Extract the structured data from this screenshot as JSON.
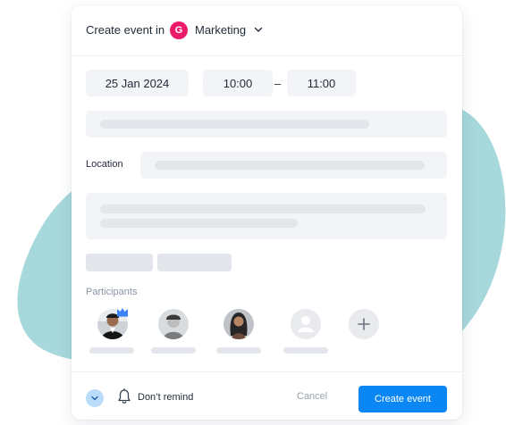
{
  "header": {
    "prefix": "Create event in",
    "team_badge": "G",
    "team_name": "Marketing",
    "team_dropdown_icon": "chevron-down-icon"
  },
  "when": {
    "date": "25 Jan 2024",
    "start_time": "10:00",
    "separator": "–",
    "end_time": "11:00"
  },
  "location": {
    "label": "Location"
  },
  "participants": {
    "label": "Participants",
    "organizer_icon": "crown-icon",
    "add_icon": "plus-icon",
    "placeholder_icon": "user-silhouette-icon"
  },
  "footer": {
    "expand_icon": "chevron-down-icon",
    "remind_icon": "bell-icon",
    "remind_label": "Don’t remind",
    "cancel_label": "Cancel",
    "create_label": "Create event"
  },
  "colors": {
    "accent": "#0a86f5",
    "team_badge": "#ec1b6a",
    "blob": "#a7d8db",
    "skeleton": "#e3e6ea",
    "field_bg": "#f2f4f7"
  }
}
